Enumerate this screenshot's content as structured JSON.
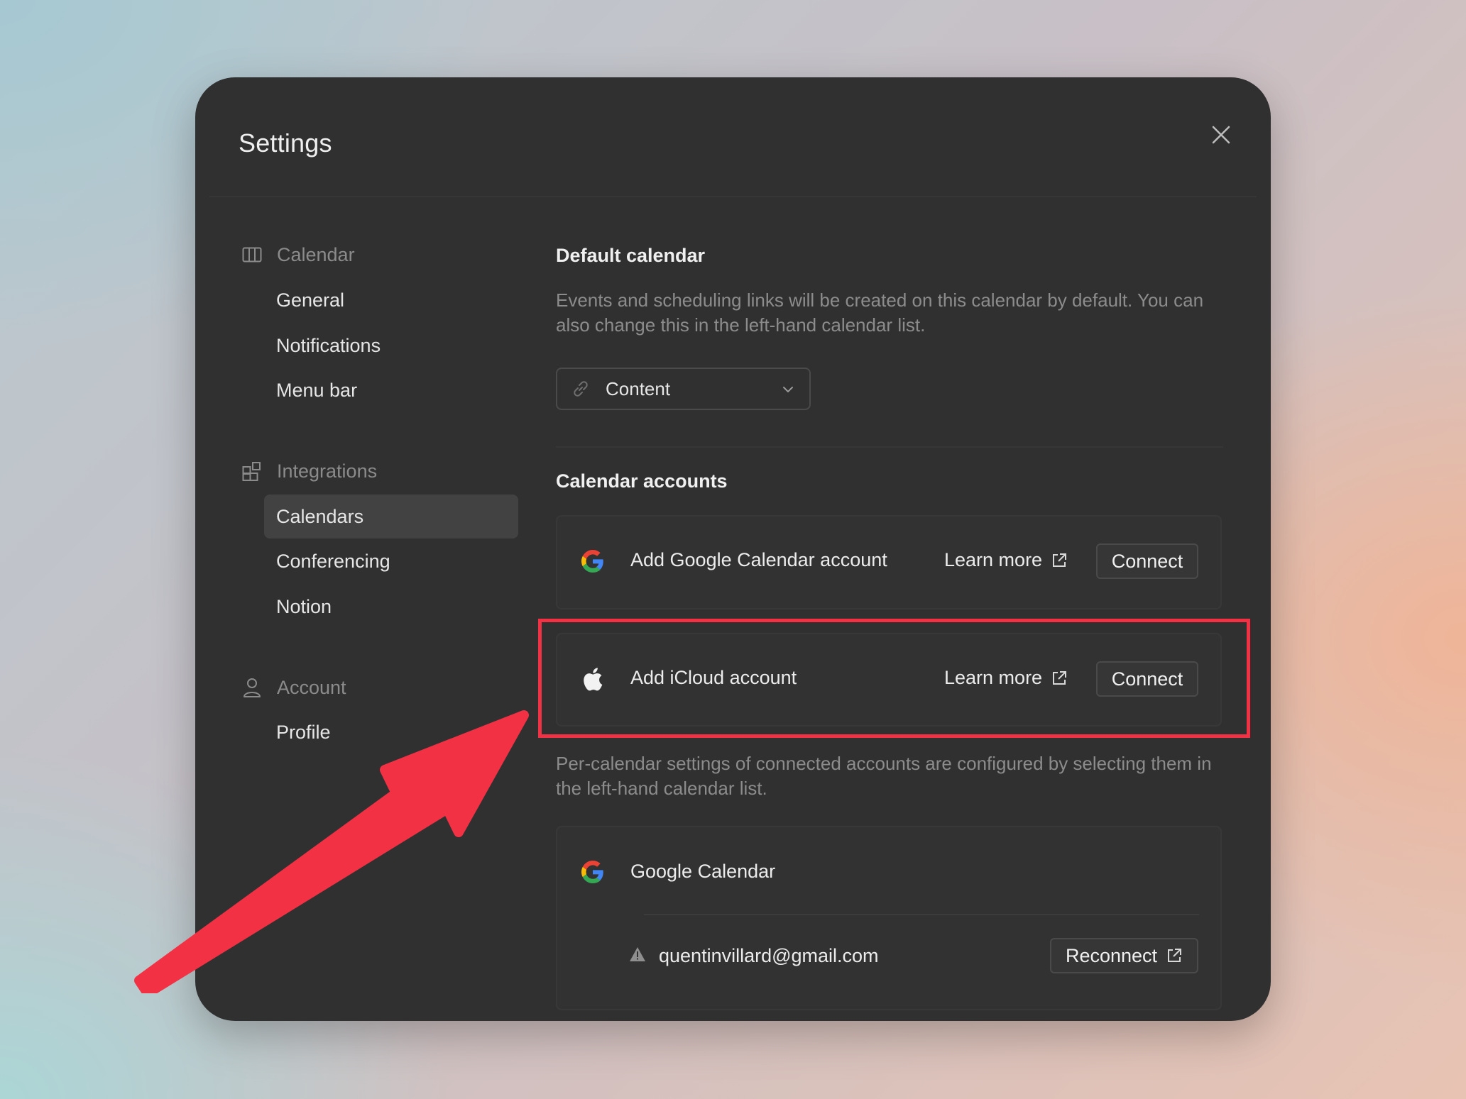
{
  "window": {
    "title": "Settings"
  },
  "sidebar": {
    "groups": [
      {
        "label": "Calendar",
        "icon": "calendar-columns-icon",
        "items": [
          "General",
          "Notifications",
          "Menu bar"
        ]
      },
      {
        "label": "Integrations",
        "icon": "integrations-grid-icon",
        "items": [
          "Calendars",
          "Conferencing",
          "Notion"
        ]
      },
      {
        "label": "Account",
        "icon": "person-icon",
        "items": [
          "Profile"
        ]
      }
    ],
    "active_item": "Calendars"
  },
  "default_calendar": {
    "title": "Default calendar",
    "description": "Events and scheduling links will be created on this calendar by default. You can also change this in the left-hand calendar list.",
    "select_value": "Content",
    "select_icon": "link-icon"
  },
  "calendar_accounts": {
    "title": "Calendar accounts",
    "providers": [
      {
        "label": "Add Google Calendar account",
        "icon": "google-g-icon",
        "learn_more": "Learn more",
        "button": "Connect"
      },
      {
        "label": "Add iCloud account",
        "icon": "apple-icon",
        "learn_more": "Learn more",
        "button": "Connect"
      }
    ],
    "note": "Per-calendar settings of connected accounts are configured by selecting them in the left-hand calendar list.",
    "connected": {
      "provider": "Google Calendar",
      "icon": "google-g-icon",
      "email": "quentinvillard@gmail.com",
      "warning_icon": "warning-triangle-icon",
      "button": "Reconnect"
    }
  },
  "annotation": {
    "highlight_color": "#f23244",
    "arrow_color": "#f23244"
  }
}
